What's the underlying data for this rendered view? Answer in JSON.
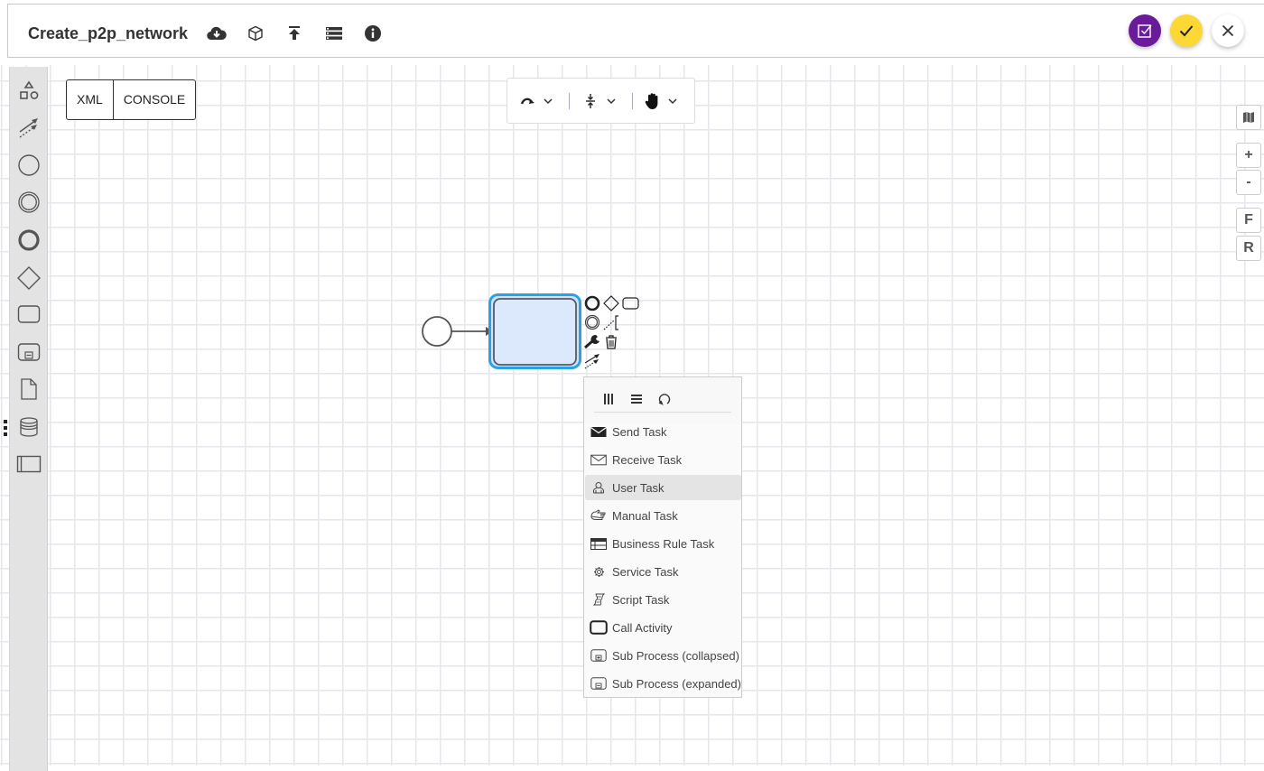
{
  "header": {
    "title": "Create_p2p_network",
    "icons": [
      "cloud-download-icon",
      "cube-icon",
      "upload-icon",
      "list-icon",
      "info-icon"
    ],
    "actions": [
      {
        "name": "validate-button",
        "icon": "checkbox-icon",
        "color": "#6a1b9a"
      },
      {
        "name": "save-button",
        "icon": "check-icon",
        "color": "#fdd835"
      },
      {
        "name": "close-button",
        "icon": "close-icon",
        "color": "#ffffff"
      }
    ]
  },
  "tabs": [
    {
      "label": "XML"
    },
    {
      "label": "CONSOLE"
    }
  ],
  "palette": {
    "items": [
      "shapes-icon",
      "global-connect-icon",
      "start-event-icon",
      "intermediate-event-icon",
      "end-event-icon",
      "gateway-icon",
      "task-icon",
      "subprocess-icon",
      "data-object-icon",
      "data-store-icon",
      "pool-icon"
    ]
  },
  "toolbar": {
    "items": [
      "connection-icon",
      "space-tool-icon",
      "hand-tool-icon"
    ]
  },
  "side_controls": {
    "minimap": "map-icon",
    "zoom_in": "+",
    "zoom_out": "-",
    "fit": "F",
    "reset": "R"
  },
  "diagram": {
    "colors": {
      "selection": "#29a3e6",
      "task_fill": "#dce8fb",
      "task_stroke": "#555a66"
    }
  },
  "replace_menu": {
    "header_icons": [
      "parallel-multi-instance-icon",
      "sequential-multi-instance-icon",
      "loop-icon"
    ],
    "entries": [
      {
        "label": "Send Task",
        "icon": "send-task-icon"
      },
      {
        "label": "Receive Task",
        "icon": "receive-task-icon"
      },
      {
        "label": "User Task",
        "icon": "user-task-icon",
        "highlighted": true
      },
      {
        "label": "Manual Task",
        "icon": "manual-task-icon"
      },
      {
        "label": "Business Rule Task",
        "icon": "business-rule-task-icon"
      },
      {
        "label": "Service Task",
        "icon": "service-task-icon"
      },
      {
        "label": "Script Task",
        "icon": "script-task-icon"
      },
      {
        "label": "Call Activity",
        "icon": "call-activity-icon"
      },
      {
        "label": "Sub Process (collapsed)",
        "icon": "subprocess-collapsed-icon"
      },
      {
        "label": "Sub Process (expanded)",
        "icon": "subprocess-expanded-icon"
      }
    ]
  }
}
